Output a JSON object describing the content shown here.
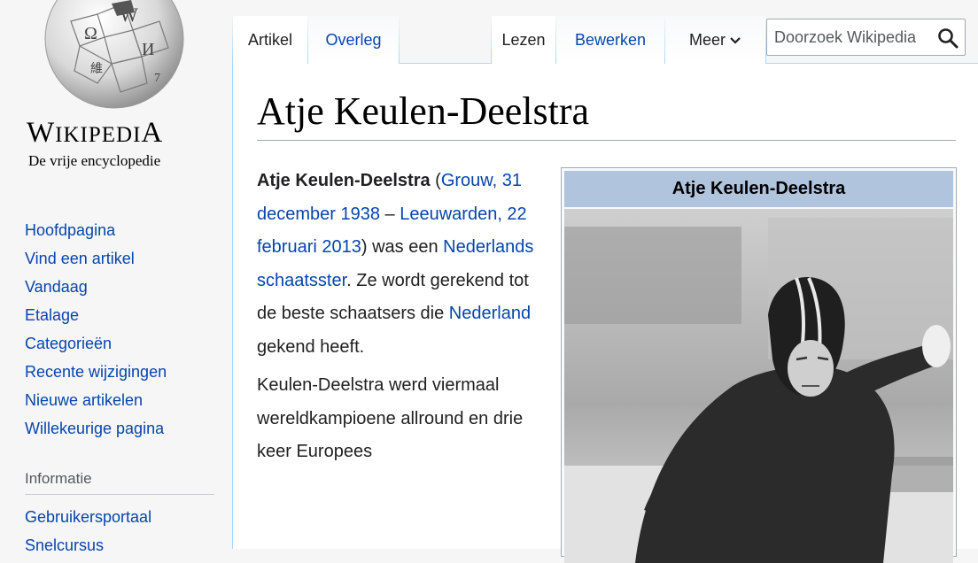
{
  "brand": {
    "wordmark_first": "W",
    "wordmark_small": "IKIPEDI",
    "wordmark_last": "A",
    "tagline": "De vrije encyclopedie"
  },
  "sidebar": {
    "navigation": [
      {
        "label": "Hoofdpagina"
      },
      {
        "label": "Vind een artikel"
      },
      {
        "label": "Vandaag"
      },
      {
        "label": "Etalage"
      },
      {
        "label": "Categorieën"
      },
      {
        "label": "Recente wijzigingen"
      },
      {
        "label": "Nieuwe artikelen"
      },
      {
        "label": "Willekeurige pagina"
      }
    ],
    "info_heading": "Informatie",
    "info_items": [
      {
        "label": "Gebruikersportaal"
      },
      {
        "label": "Snelcursus"
      }
    ]
  },
  "tabs": {
    "article": "Artikel",
    "talk": "Overleg",
    "read": "Lezen",
    "edit": "Bewerken",
    "more": "Meer"
  },
  "search": {
    "placeholder": "Doorzoek Wikipedia",
    "icon": "search-icon"
  },
  "article": {
    "title": "Atje Keulen-Deelstra",
    "p1": {
      "name": "Atje Keulen-Deelstra",
      "s1": " (",
      "link_birthplace": "Grouw,",
      "s2": " ",
      "link_birthdate": "31 december 1938",
      "s3": " – ",
      "link_death": "Leeuwarden, 22 februari 2013",
      "s4": ") was een ",
      "link_nl": "Nederlands",
      "s5": " ",
      "link_skater": "schaatsster",
      "s6": ". Ze wordt gerekend tot de beste schaatsers die ",
      "link_country": "Nederland",
      "s7": " gekend heeft."
    },
    "p2": "Keulen-Deelstra werd viermaal wereldkampioene allround en drie keer Europees"
  },
  "infobox": {
    "title": "Atje Keulen-Deelstra"
  },
  "colors": {
    "link": "#0645ad",
    "infobox_header": "#b0c4de",
    "tab_border": "#a7d7f9"
  }
}
